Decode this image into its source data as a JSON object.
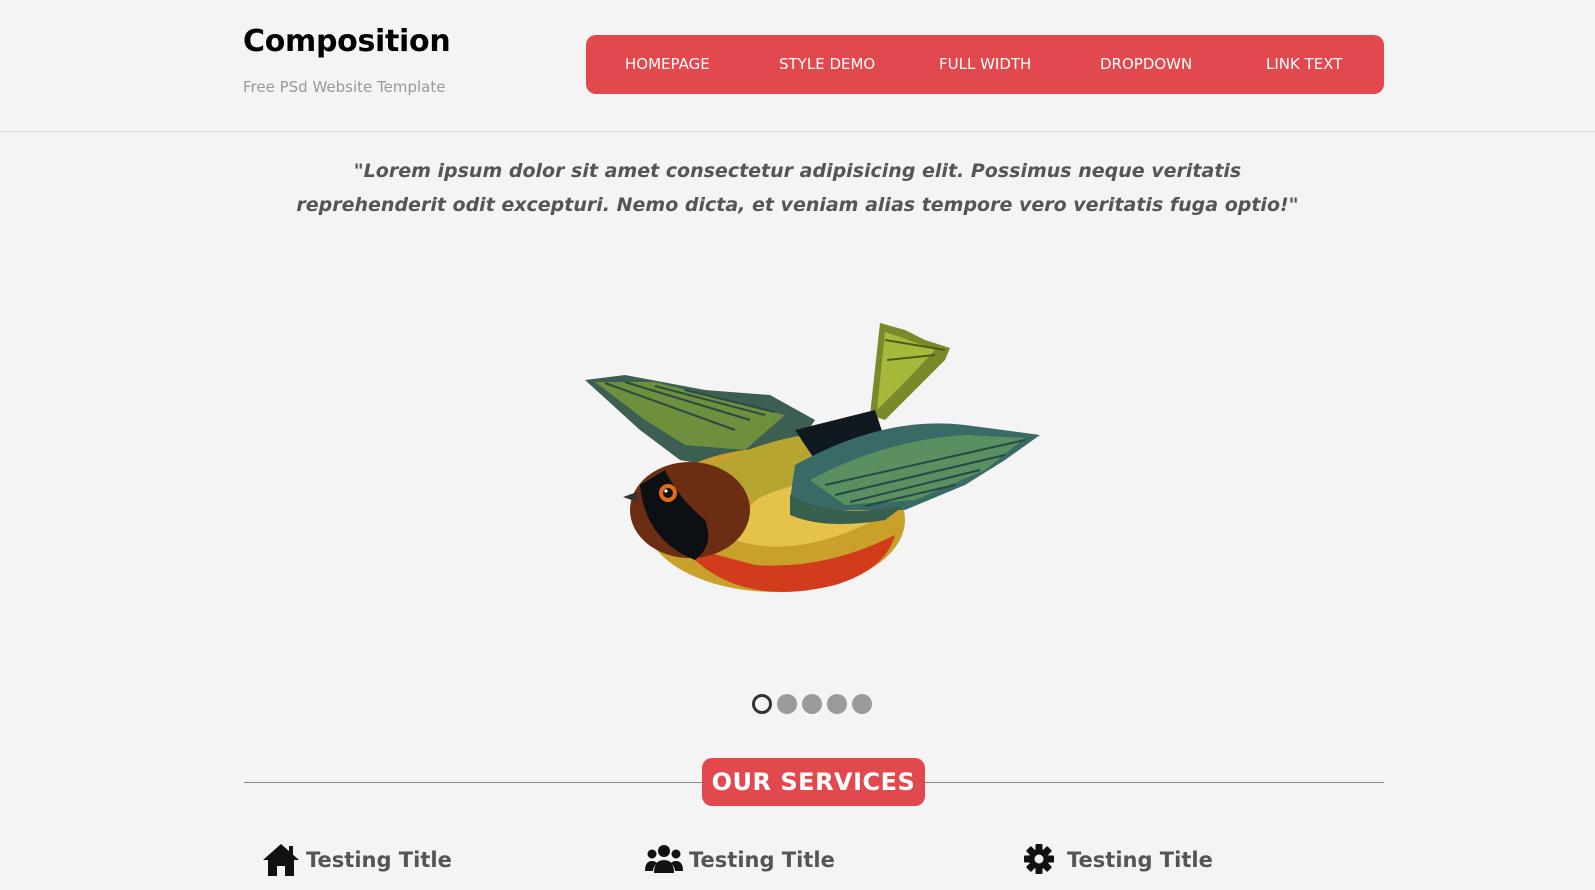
{
  "site": {
    "title": "Composition",
    "tagline": "Free PSd Website Template"
  },
  "nav": {
    "items": [
      {
        "label": "HOMEPAGE"
      },
      {
        "label": "STYLE DEMO"
      },
      {
        "label": "FULL WIDTH"
      },
      {
        "label": "DROPDOWN"
      },
      {
        "label": "LINK TEXT"
      }
    ]
  },
  "hero": {
    "quote": "\"Lorem ipsum dolor sit amet consectetur adipisicing elit. Possimus neque veritatis reprehenderit odit excepturi. Nemo dicta, et veniam alias tempore vero veritatis fuga optio!\"",
    "slider": {
      "slide_count": 5,
      "active_slide": 1
    }
  },
  "services": {
    "heading": "OUR SERVICES",
    "items": [
      {
        "icon": "home-icon",
        "title": "Testing Title"
      },
      {
        "icon": "users-icon",
        "title": "Testing Title"
      },
      {
        "icon": "gear-icon",
        "title": "Testing Title"
      }
    ]
  },
  "colors": {
    "accent": "#e2494f",
    "background": "#f5f4f4"
  }
}
